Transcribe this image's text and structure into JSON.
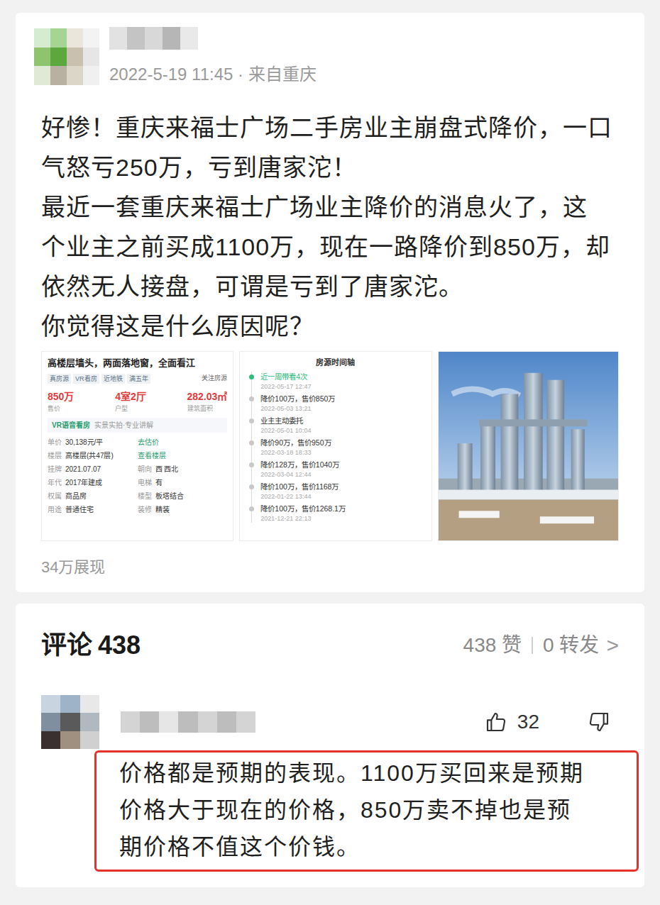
{
  "post": {
    "timestamp": "2022-5-19 11:45 · 来自重庆",
    "lines": [
      "好惨！重庆来福士广场二手房业主崩盘式降价，一口",
      "气怒亏250万，亏到唐家沱！",
      "最近一套重庆来福士广场业主降价的消息火了，这",
      "个业主之前买成1100万，现在一路降价到850万，却",
      "依然无人接盘，可谓是亏到了唐家沱。",
      "你觉得这是什么原因呢？"
    ],
    "images": [
      {
        "kind": "listing",
        "title": "高楼层墙头，两面落地窗，全面看江",
        "tags": [
          "真房源",
          "VR看房",
          "近地铁",
          "满五年"
        ],
        "follow": "关注房源",
        "stats": [
          {
            "value": "850万",
            "label": "售价"
          },
          {
            "value": "4室2厅",
            "label": "户型"
          },
          {
            "value": "282.03㎡",
            "label": "建筑面积"
          }
        ],
        "vr": "VR语音看房",
        "vr_note": "实景实拍·专业讲解",
        "rows": [
          [
            {
              "kind": "field",
              "label": "单价",
              "value": "30,138元/平"
            },
            {
              "kind": "link",
              "value": "去估价"
            }
          ],
          [
            {
              "kind": "field",
              "label": "楼层",
              "value": "高楼层(共47层)"
            },
            {
              "kind": "link",
              "value": "查看楼层"
            }
          ],
          [
            {
              "kind": "field",
              "label": "挂牌",
              "value": "2021.07.07"
            },
            {
              "kind": "field",
              "label": "朝向",
              "value": "西 西北"
            }
          ],
          [
            {
              "kind": "field",
              "label": "年代",
              "value": "2017年建成"
            },
            {
              "kind": "field",
              "label": "电梯",
              "value": "有"
            }
          ],
          [
            {
              "kind": "field",
              "label": "权属",
              "value": "商品房"
            },
            {
              "kind": "field",
              "label": "楼型",
              "value": "板塔结合"
            }
          ],
          [
            {
              "kind": "field",
              "label": "用途",
              "value": "普通住宅"
            },
            {
              "kind": "field",
              "label": "装修",
              "value": "精装"
            }
          ]
        ]
      },
      {
        "kind": "timeline",
        "title": "房源时间轴",
        "entries": [
          {
            "text": "近一周带看4次",
            "date": "2022-05-17 12:47",
            "selected": true
          },
          {
            "text": "降价100万，售价850万",
            "date": "2022-05-03 13:21",
            "selected": false
          },
          {
            "text": "业主主动委托",
            "date": "2022-05-01 10:04",
            "selected": false
          },
          {
            "text": "降价90万，售价950万",
            "date": "2022-03-18 18:33",
            "selected": false
          },
          {
            "text": "降价128万，售价1040万",
            "date": "2022-03-04 12:44",
            "selected": false
          },
          {
            "text": "降价100万，售价1168万",
            "date": "2022-01-22 13:44",
            "selected": false
          },
          {
            "text": "降价100万，售价1268.1万",
            "date": "2021-12-21 22:13",
            "selected": false
          }
        ]
      },
      {
        "kind": "photo"
      }
    ],
    "views": "34万展现"
  },
  "comments": {
    "label": "评论",
    "count": "438",
    "likes": "438 赞",
    "shares": "0 转发",
    "more": ">"
  },
  "comment": {
    "likes": "32",
    "highlighted": true,
    "lines": [
      "价格都是预期的表现。1100万买回来是预期",
      "价格大于现在的价格，850万卖不掉也是预",
      "期价格不值这个价钱。"
    ]
  }
}
